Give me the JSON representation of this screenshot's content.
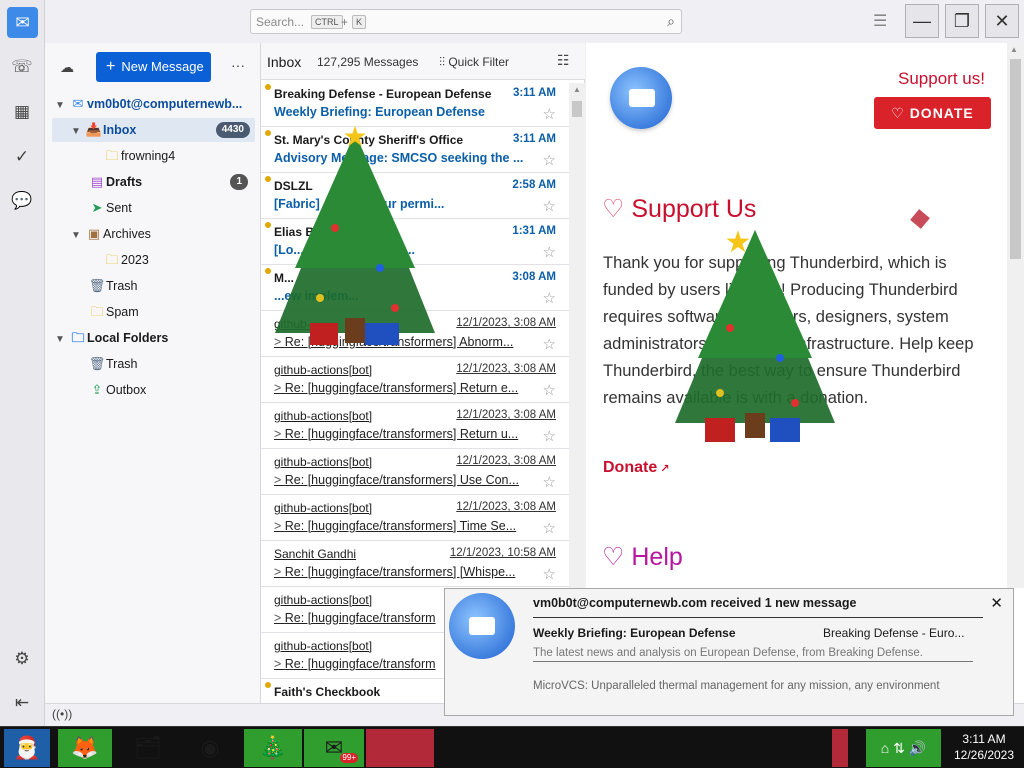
{
  "search": {
    "placeholder": "Search...",
    "key1": "CTRL",
    "plus": "+",
    "key2": "K"
  },
  "window": {
    "minimize": "—",
    "restore": "❐",
    "close": "✕"
  },
  "folder_pane": {
    "new_message": "New Message",
    "more": "···",
    "account": "vm0b0t@computernewb...",
    "folders": [
      {
        "label": "Inbox",
        "badge": "4430"
      },
      {
        "label": "frowning4"
      },
      {
        "label": "Drafts",
        "badge": "1"
      },
      {
        "label": "Sent"
      },
      {
        "label": "Archives"
      },
      {
        "label": "2023"
      },
      {
        "label": "Trash"
      },
      {
        "label": "Spam"
      }
    ],
    "local_folders": "Local Folders",
    "local": [
      {
        "label": "Trash"
      },
      {
        "label": "Outbox"
      }
    ]
  },
  "list": {
    "title": "Inbox",
    "count": "127,295 Messages",
    "quick_filter": "Quick Filter",
    "rows": [
      {
        "sender": "Breaking Defense - European Defense",
        "date": "3:11 AM",
        "subject": "Weekly Briefing: European Defense",
        "state": "unread"
      },
      {
        "sender": "St. Mary's County Sheriff's Office",
        "date": "3:11 AM",
        "subject": "Advisory Message: SMCSO seeking the ...",
        "state": "unread"
      },
      {
        "sender": "DSLZL",
        "date": "2:58 AM",
        "subject": "[Fabric] Ask for your permi...",
        "state": "unread"
      },
      {
        "sender": "Elias Ba...",
        "date": "1:31 AM",
        "subject": "[Lo... system_prompt]...",
        "state": "unread"
      },
      {
        "sender": "M...",
        "date": "3:08 AM",
        "subject": "...ew implem...",
        "state": "unread"
      },
      {
        "sender": "github-...",
        "date": "12/1/2023, 3:08 AM",
        "subject": "Re: [huggingface/transformers] Abnorm...",
        "state": "read"
      },
      {
        "sender": "github-actions[bot]",
        "date": "12/1/2023, 3:08 AM",
        "subject": "Re: [huggingface/transformers] Return e...",
        "state": "read"
      },
      {
        "sender": "github-actions[bot]",
        "date": "12/1/2023, 3:08 AM",
        "subject": "Re: [huggingface/transformers] Return u...",
        "state": "read"
      },
      {
        "sender": "github-actions[bot]",
        "date": "12/1/2023, 3:08 AM",
        "subject": "Re: [huggingface/transformers] Use Con...",
        "state": "read"
      },
      {
        "sender": "github-actions[bot]",
        "date": "12/1/2023, 3:08 AM",
        "subject": "Re: [huggingface/transformers] Time Se...",
        "state": "read"
      },
      {
        "sender": "Sanchit Gandhi",
        "date": "12/1/2023, 10:58 AM",
        "subject": "Re: [huggingface/transformers] [Whispe...",
        "state": "read"
      },
      {
        "sender": "github-actions[bot]",
        "date": "",
        "subject": "Re: [huggingface/transform",
        "state": "read"
      },
      {
        "sender": "github-actions[bot]",
        "date": "",
        "subject": "Re: [huggingface/transform",
        "state": "read"
      },
      {
        "sender": "Faith's Checkbook",
        "date": "",
        "subject": "",
        "state": "unread"
      }
    ]
  },
  "reading": {
    "support_us_link": "Support us!",
    "donate_button": "DONATE",
    "support_heading": "Support Us",
    "support_body": "Thank you for supporting Thunderbird, which is funded by users like you! Producing Thunderbird requires software engineers, designers, system administrators and server infrastructure. Help keep Thunderbird, the best way to ensure Thunderbird remains available is with a donation.",
    "donate_link": "Donate",
    "help_heading": "Help"
  },
  "notification": {
    "title": "vm0b0t@computernewb.com received 1 new message",
    "subject": "Weekly Briefing: European Defense",
    "from": "Breaking Defense - Euro...",
    "body1": "The latest news and analysis on European Defense, from Breaking Defense.",
    "body2": "MicroVCS: Unparalleled thermal management for any mission, any environment"
  },
  "taskbar": {
    "time": "3:11 AM",
    "date": "12/26/2023",
    "badge": "99+"
  },
  "colors": {
    "accent": "#0b60d6",
    "donate": "#d9222a",
    "heading": "#c8102e",
    "help": "#b5179e"
  }
}
